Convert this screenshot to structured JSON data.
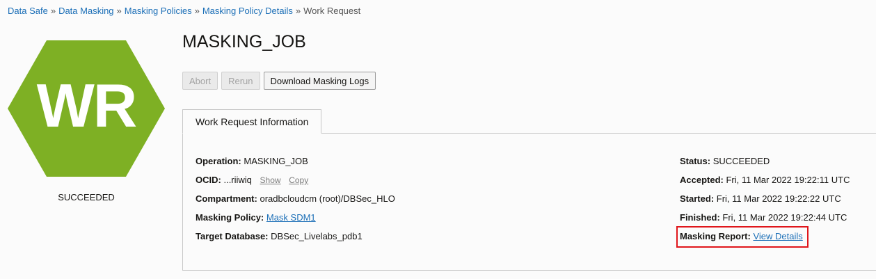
{
  "breadcrumb": {
    "items": [
      "Data Safe",
      "Data Masking",
      "Masking Policies",
      "Masking Policy Details"
    ],
    "current": "Work Request",
    "separator": "»"
  },
  "badge": {
    "initials": "WR",
    "color": "#7eb024",
    "status": "SUCCEEDED"
  },
  "title": "MASKING_JOB",
  "actions": {
    "abort": "Abort",
    "rerun": "Rerun",
    "download_logs": "Download Masking Logs"
  },
  "tab": {
    "label": "Work Request Information"
  },
  "info_left": {
    "operation_label": "Operation:",
    "operation_value": "MASKING_JOB",
    "ocid_label": "OCID:",
    "ocid_value": "...riiwiq",
    "ocid_show": "Show",
    "ocid_copy": "Copy",
    "compartment_label": "Compartment:",
    "compartment_value": "oradbcloudcm (root)/DBSec_HLO",
    "policy_label": "Masking Policy:",
    "policy_value": "Mask SDM1",
    "target_label": "Target Database:",
    "target_value": "DBSec_Livelabs_pdb1"
  },
  "info_right": {
    "status_label": "Status:",
    "status_value": "SUCCEEDED",
    "accepted_label": "Accepted:",
    "accepted_value": "Fri, 11 Mar 2022 19:22:11 UTC",
    "started_label": "Started:",
    "started_value": "Fri, 11 Mar 2022 19:22:22 UTC",
    "finished_label": "Finished:",
    "finished_value": "Fri, 11 Mar 2022 19:22:44 UTC",
    "report_label": "Masking Report:",
    "report_link": "View Details"
  },
  "colors": {
    "link": "#1c6fb7",
    "highlight": "#e0161b"
  }
}
